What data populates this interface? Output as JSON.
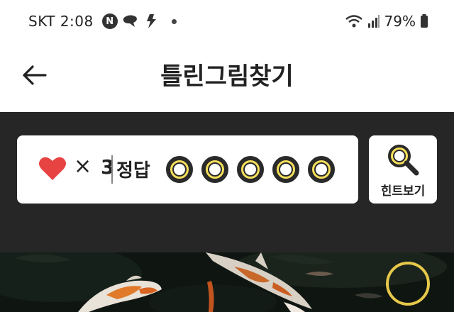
{
  "status_bar": {
    "carrier_time": "SKT 2:08",
    "notification_badge": "N",
    "battery_percent": "79%"
  },
  "header": {
    "title": "틀린그림찾기"
  },
  "score": {
    "times_symbol": "×",
    "lives_count": "3",
    "answer_label": "정답",
    "answer_slots_total": 5,
    "answer_slots_found": 0
  },
  "hint": {
    "label": "힌트보기"
  },
  "colors": {
    "heart": "#e74343",
    "accent_yellow": "#f5df5a",
    "dark_panel": "#262626"
  },
  "icons": {
    "back": "arrow-left-icon",
    "heart": "heart-icon",
    "hint": "magnifier-icon",
    "wifi": "wifi-icon",
    "signal": "signal-icon",
    "battery": "battery-icon"
  }
}
